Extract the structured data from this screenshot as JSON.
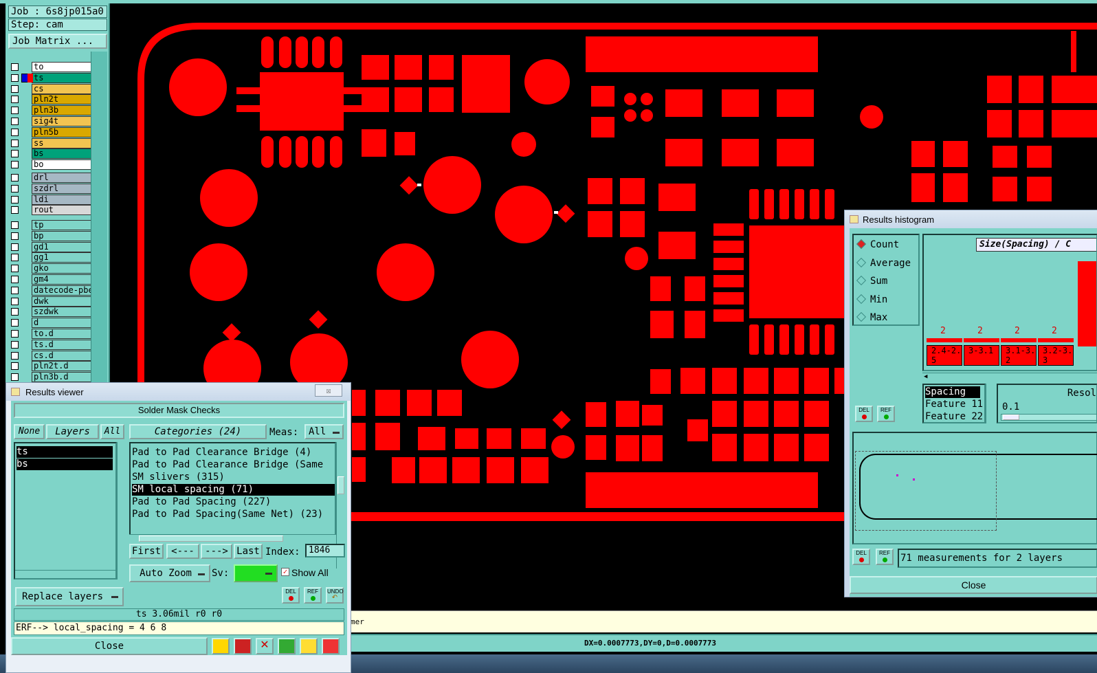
{
  "job": {
    "label": "Job : 6s8jp015a0",
    "step": "Step: cam",
    "matrix_button": "Job Matrix ..."
  },
  "layers": [
    {
      "name": "to",
      "color": "#ffffff",
      "active": false
    },
    {
      "name": "ts",
      "color": "#00a27a",
      "active": true
    },
    {
      "name": "cs",
      "color": "#f2c451",
      "active": false
    },
    {
      "name": "pln2t",
      "color": "#d9a800",
      "active": false
    },
    {
      "name": "pln3b",
      "color": "#d9a800",
      "active": false
    },
    {
      "name": "sig4t",
      "color": "#f2c451",
      "active": false
    },
    {
      "name": "pln5b",
      "color": "#d9a800",
      "active": false
    },
    {
      "name": "ss",
      "color": "#f2c451",
      "active": false
    },
    {
      "name": "bs",
      "color": "#00a27a",
      "active": false
    },
    {
      "name": "bo",
      "color": "#ffffff",
      "active": false
    },
    {
      "name": "drl",
      "color": "#a6b8c4",
      "active": false
    },
    {
      "name": "szdrl",
      "color": "#a6b8c4",
      "active": false
    },
    {
      "name": "ldi",
      "color": "#a6b8c4",
      "active": false
    },
    {
      "name": "rout",
      "color": "#d8d8d8",
      "active": false
    },
    {
      "name": "tp",
      "color": "#7fd4c8",
      "active": false
    },
    {
      "name": "bp",
      "color": "#7fd4c8",
      "active": false
    },
    {
      "name": "gd1",
      "color": "#7fd4c8",
      "active": false
    },
    {
      "name": "gg1",
      "color": "#7fd4c8",
      "active": false
    },
    {
      "name": "gko",
      "color": "#7fd4c8",
      "active": false
    },
    {
      "name": "gm4",
      "color": "#7fd4c8",
      "active": false
    },
    {
      "name": "datecode-pbe",
      "color": "#7fd4c8",
      "active": false
    },
    {
      "name": "dwk",
      "color": "#7fd4c8",
      "active": false
    },
    {
      "name": "szdwk",
      "color": "#7fd4c8",
      "active": false
    },
    {
      "name": "d",
      "color": "#7fd4c8",
      "active": false
    },
    {
      "name": "to.d",
      "color": "#7fd4c8",
      "active": false
    },
    {
      "name": "ts.d",
      "color": "#7fd4c8",
      "active": false
    },
    {
      "name": "cs.d",
      "color": "#7fd4c8",
      "active": false
    },
    {
      "name": "pln2t.d",
      "color": "#7fd4c8",
      "active": false
    },
    {
      "name": "pln3b.d",
      "color": "#7fd4c8",
      "active": false
    }
  ],
  "results_viewer": {
    "title": "Results viewer",
    "close_x": "☒",
    "header": "Solder Mask Checks",
    "none_btn": "None",
    "layers_btn": "Layers",
    "all_btn": "All",
    "categories_btn": "Categories (24)",
    "meas_label": "Meas:",
    "meas_value": "All",
    "layer_list": [
      "ts",
      "bs"
    ],
    "categories": [
      "Pad to Pad Clearance Bridge (4)",
      "Pad to Pad Clearance Bridge (Same",
      "SM slivers (315)",
      "SM local spacing (71)",
      "Pad to Pad Spacing (227)",
      "Pad to Pad Spacing(Same Net) (23)"
    ],
    "selected_category_index": 3,
    "first_btn": "First",
    "prev_btn": "<---",
    "next_btn": "--->",
    "last_btn": "Last",
    "index_label": "Index:",
    "index_value": "1846",
    "auto_zoom": "Auto Zoom",
    "sv_label": "Sv:",
    "show_all": "Show All",
    "replace_layers": "Replace layers",
    "info": "ts 3.06mil  r0  r0",
    "erf": "ERF--> local_spacing = 4 6 8",
    "close": "Close",
    "del_label": "DEL",
    "ref_label": "REF",
    "undo_label": "UNDO"
  },
  "results_histogram": {
    "title": "Results histogram",
    "modes": [
      "Count",
      "Average",
      "Sum",
      "Min",
      "Max"
    ],
    "selected_mode": "Count",
    "chart_title": "Size(Spacing) / C",
    "bars": [
      {
        "count": "2",
        "range": "2.4-2.5"
      },
      {
        "count": "2",
        "range": "3-3.1"
      },
      {
        "count": "2",
        "range": "3.1-3.2"
      },
      {
        "count": "2",
        "range": "3.2-3.3"
      }
    ],
    "attr_list": [
      "Spacing",
      "Feature 1",
      "Feature 2"
    ],
    "attr_values": [
      "",
      "1",
      "2"
    ],
    "resol_label": "Resol",
    "resol_value": "0.1",
    "measurements": "71 measurements for 2 layers",
    "close": "Close",
    "del_label": "DEL",
    "ref_label": "REF"
  },
  "status": {
    "text": "mer"
  },
  "coords": {
    "text": "DX=0.0007773,DY=0,D=0.0007773"
  },
  "colors": {
    "pad": "#ff0000",
    "panel": "#7fd4c8",
    "background": "#000000"
  }
}
